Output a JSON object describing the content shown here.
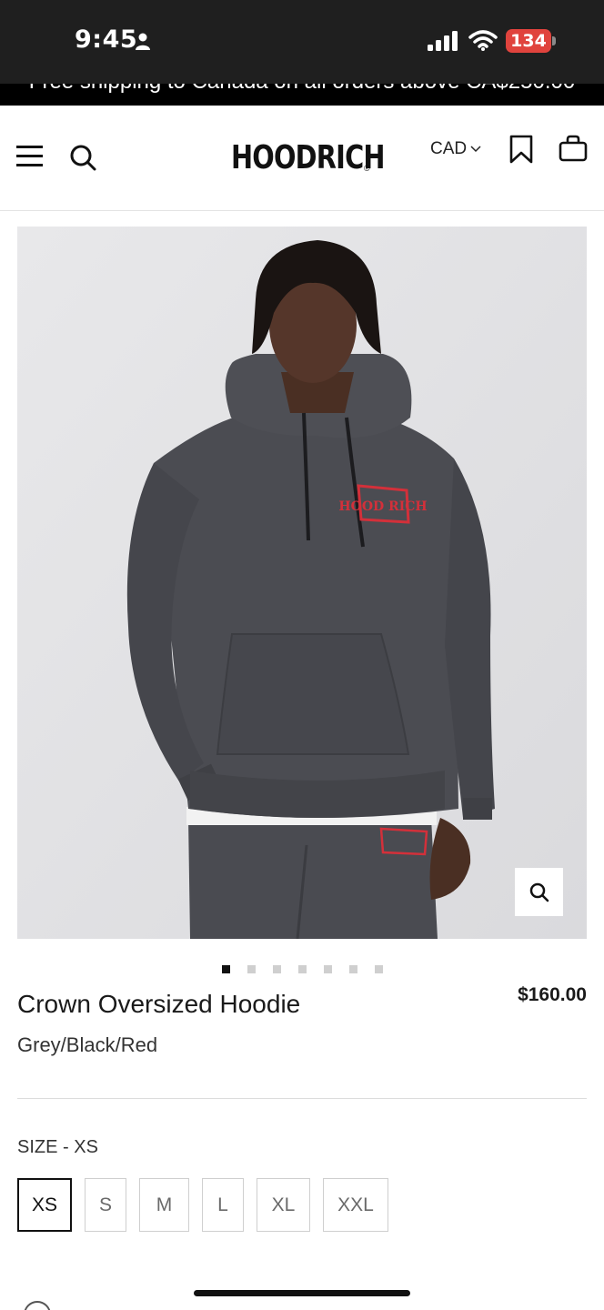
{
  "status_bar": {
    "time": "9:45",
    "battery": "134",
    "icons": [
      "person-icon",
      "signal-icon",
      "wifi-icon",
      "battery-icon"
    ]
  },
  "announcement": {
    "text": "Free shipping to Canada on all orders above CA$250.00"
  },
  "header": {
    "brand": "HOODRICH",
    "currency": "CAD",
    "icons": [
      "menu-icon",
      "search-icon",
      "bookmark-icon",
      "bag-icon",
      "chevron-down-icon"
    ]
  },
  "gallery": {
    "image_count": 7,
    "active_index": 0,
    "shirt_text": "HOOD RICH",
    "icons": [
      "zoom-icon"
    ]
  },
  "product": {
    "title": "Crown Oversized Hoodie",
    "price": "$160.00",
    "color": "Grey/Black/Red"
  },
  "size": {
    "label": "SIZE - XS",
    "selected": "XS",
    "options": [
      "XS",
      "S",
      "M",
      "L",
      "XL",
      "XXL"
    ]
  },
  "colors": {
    "status_bar": "#1f1f1f",
    "battery": "#e0433d",
    "hoodie": "#4b4c52",
    "embroidery": "#d3303a"
  }
}
